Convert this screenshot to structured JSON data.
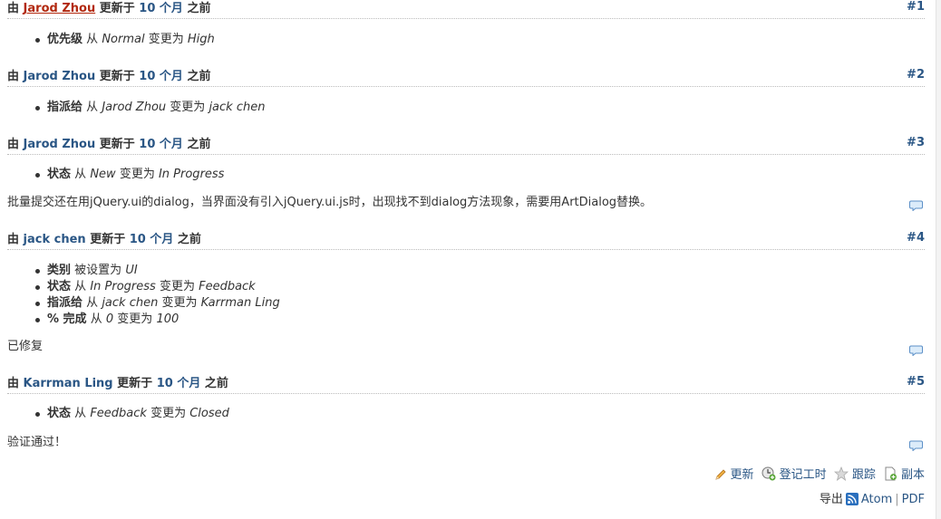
{
  "journals": [
    {
      "by": "由",
      "author": "Jarod Zhou",
      "updated": "更新于",
      "ago": "10 个月",
      "ago_suffix": "之前",
      "number": "#1",
      "details": [
        {
          "field": "优先级",
          "verb": "从",
          "old": "Normal",
          "verb2": "变更为",
          "new": "High"
        }
      ]
    },
    {
      "by": "由",
      "author": "Jarod Zhou",
      "updated": "更新于",
      "ago": "10 个月",
      "ago_suffix": "之前",
      "number": "#2",
      "details": [
        {
          "field": "指派给",
          "verb": "从",
          "old": "Jarod Zhou",
          "verb2": "变更为",
          "new": "jack chen"
        }
      ]
    },
    {
      "by": "由",
      "author": "Jarod Zhou",
      "updated": "更新于",
      "ago": "10 个月",
      "ago_suffix": "之前",
      "number": "#3",
      "details": [
        {
          "field": "状态",
          "verb": "从",
          "old": "New",
          "verb2": "变更为",
          "new": "In Progress"
        }
      ],
      "note": "批量提交还在用jQuery.ui的dialog，当界面没有引入jQuery.ui.js时，出现找不到dialog方法现象，需要用ArtDialog替换。"
    },
    {
      "by": "由",
      "author": "jack chen",
      "updated": "更新于",
      "ago": "10 个月",
      "ago_suffix": "之前",
      "number": "#4",
      "details": [
        {
          "field": "类别",
          "verb": "被设置为",
          "old": "UI"
        },
        {
          "field": "状态",
          "verb": "从",
          "old": "In Progress",
          "verb2": "变更为",
          "new": "Feedback"
        },
        {
          "field": "指派给",
          "verb": "从",
          "old": "jack chen",
          "verb2": "变更为",
          "new": "Karrman Ling"
        },
        {
          "field": "% 完成",
          "verb": "从",
          "old": "0",
          "verb2": "变更为",
          "new": "100"
        }
      ],
      "note": "已修复"
    },
    {
      "by": "由",
      "author": "Karrman Ling",
      "updated": "更新于",
      "ago": "10 个月",
      "ago_suffix": "之前",
      "number": "#5",
      "details": [
        {
          "field": "状态",
          "verb": "从",
          "old": "Feedback",
          "verb2": "变更为",
          "new": "Closed"
        }
      ],
      "note": "验证通过！"
    }
  ],
  "actions": {
    "update": "更新",
    "log_time": "登记工时",
    "watch": "跟踪",
    "copy": "副本"
  },
  "export": {
    "label": "导出",
    "atom": "Atom",
    "separator": "|",
    "pdf": "PDF"
  },
  "colors": {
    "link": "#2a5685",
    "link_hover": "#b2290f",
    "text": "#333333"
  }
}
